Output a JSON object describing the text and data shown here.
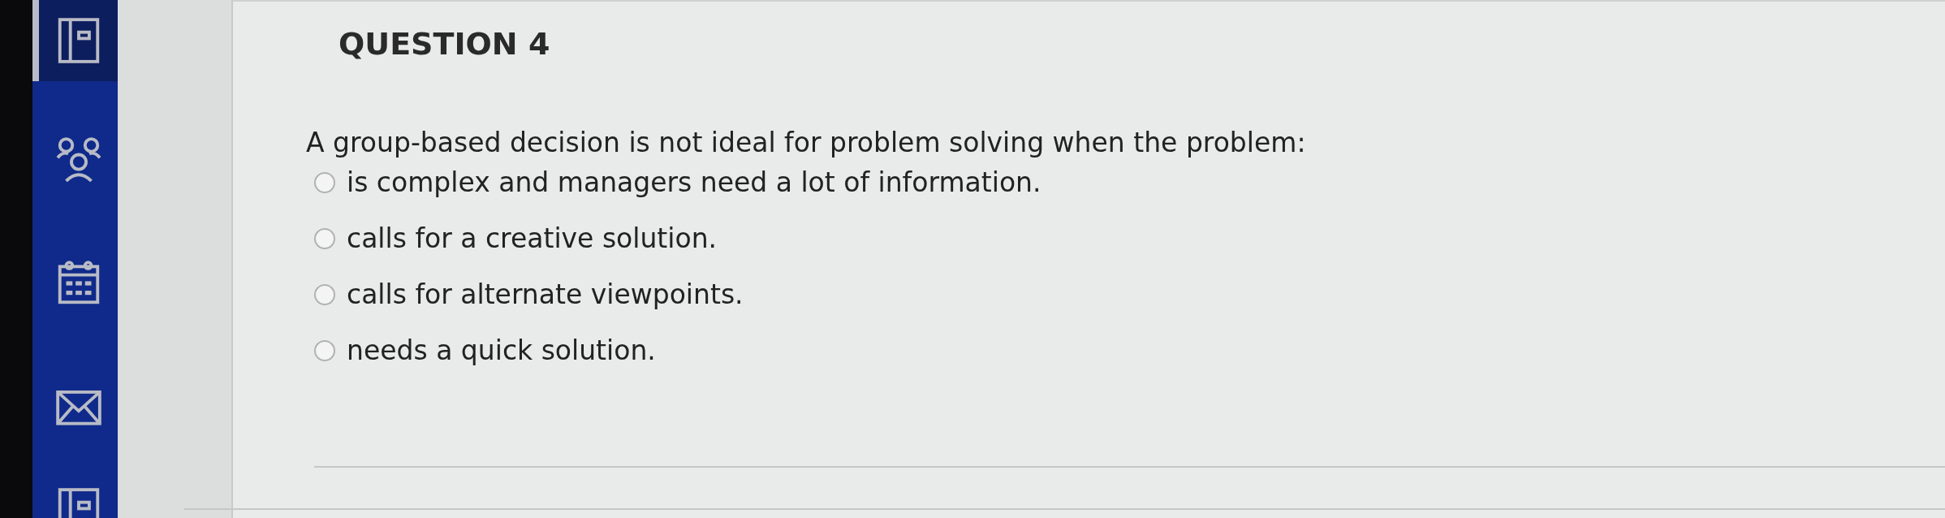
{
  "sidebar": {
    "items": [
      {
        "kind": "document",
        "selected": true
      },
      {
        "kind": "people",
        "selected": false
      },
      {
        "kind": "calendar",
        "selected": false
      },
      {
        "kind": "mail",
        "selected": false
      },
      {
        "kind": "document",
        "selected": false
      }
    ]
  },
  "question": {
    "title": "QUESTION 4",
    "prompt": "A group-based decision is not ideal for problem solving when the problem:",
    "options": [
      {
        "label": "is complex and managers need a lot of information.",
        "selected": false
      },
      {
        "label": "calls for a creative solution.",
        "selected": false
      },
      {
        "label": "calls for alternate viewpoints.",
        "selected": false
      },
      {
        "label": "needs a quick solution.",
        "selected": false
      }
    ]
  }
}
